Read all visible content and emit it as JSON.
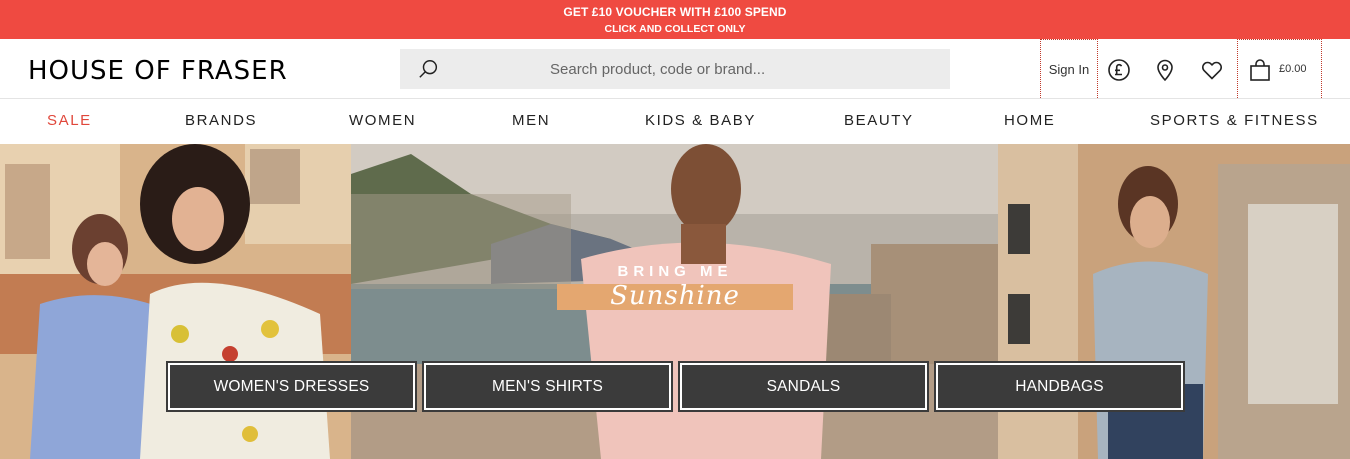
{
  "promo": {
    "line1": "GET £10 VOUCHER WITH £100 SPEND",
    "line2": "CLICK AND COLLECT ONLY"
  },
  "header": {
    "logo": "HOUSE OF FRASER",
    "search_placeholder": "Search product, code or brand...",
    "sign_in": "Sign In",
    "bag_amount": "£0.00",
    "icons": [
      "search-icon",
      "currency-pound-icon",
      "location-pin-icon",
      "heart-icon",
      "shopping-bag-icon"
    ]
  },
  "nav": {
    "items": [
      "SALE",
      "BRANDS",
      "WOMEN",
      "MEN",
      "KIDS & BABY",
      "BEAUTY",
      "HOME",
      "SPORTS & FITNESS"
    ],
    "sale_color": "#e0473b"
  },
  "hero": {
    "tagline_top": "BRING ME",
    "tagline_script": "Sunshine",
    "buttons": [
      "WOMEN'S DRESSES",
      "MEN'S SHIRTS",
      "SANDALS",
      "HANDBAGS"
    ]
  },
  "colors": {
    "promo_bg": "#ef4a41",
    "button_bg": "#3b3b3b",
    "accent_orange": "#e4a770"
  }
}
